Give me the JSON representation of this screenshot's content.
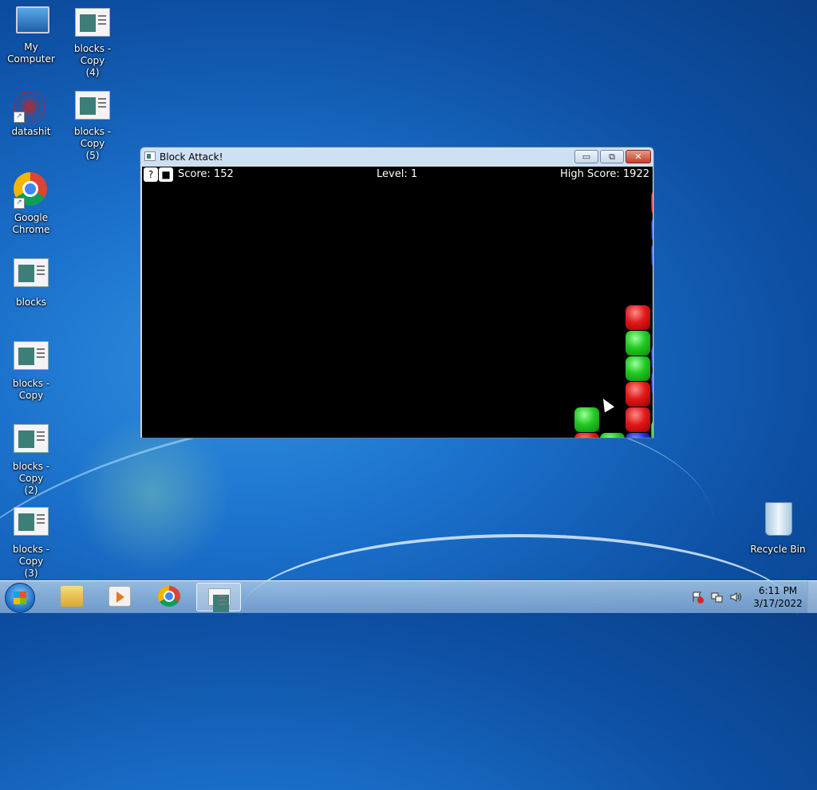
{
  "desktop": {
    "icons": [
      {
        "label": "My Computer",
        "icon": "computer-icon"
      },
      {
        "label": "blocks - Copy\n(4)",
        "icon": "app-window-icon"
      },
      {
        "label": "datashit",
        "icon": "shortcut-icon"
      },
      {
        "label": "blocks - Copy\n(5)",
        "icon": "app-window-icon"
      },
      {
        "label": "Google\nChrome",
        "icon": "chrome-icon"
      },
      {
        "label": "blocks",
        "icon": "app-window-icon"
      },
      {
        "label": "blocks - Copy",
        "icon": "app-window-icon"
      },
      {
        "label": "blocks - Copy\n(2)",
        "icon": "app-window-icon"
      },
      {
        "label": "blocks - Copy\n(3)",
        "icon": "app-window-icon"
      },
      {
        "label": "Recycle Bin",
        "icon": "recycle-bin-icon"
      }
    ]
  },
  "window": {
    "title": "Block Attack!",
    "minimize_glyph": "▭",
    "maximize_glyph": "⧉",
    "close_glyph": "✕"
  },
  "game": {
    "help_button": "?",
    "stop_button": "■",
    "score": "Score: 152",
    "level": "Level: 1",
    "high_score": "High Score: 1922",
    "blocks": [
      {
        "col": 2,
        "row": 5,
        "color": "red"
      },
      {
        "col": 2,
        "row": 6,
        "color": "green"
      },
      {
        "col": 2,
        "row": 7,
        "color": "green"
      },
      {
        "col": 2,
        "row": 8,
        "color": "red"
      },
      {
        "col": 2,
        "row": 9,
        "color": "red"
      },
      {
        "col": 0,
        "row": 9,
        "color": "green"
      },
      {
        "col": 0,
        "row": 10,
        "color": "red"
      },
      {
        "col": 1,
        "row": 10,
        "color": "green"
      },
      {
        "col": 2,
        "row": 10,
        "color": "blue"
      }
    ]
  },
  "taskbar": {
    "items": [
      "start",
      "explorer",
      "media-player",
      "chrome",
      "block-attack"
    ],
    "time": "6:11 PM",
    "date": "3/17/2022"
  },
  "colors": {
    "red": "#e01818",
    "green": "#22c822",
    "blue": "#1a2ee0"
  }
}
